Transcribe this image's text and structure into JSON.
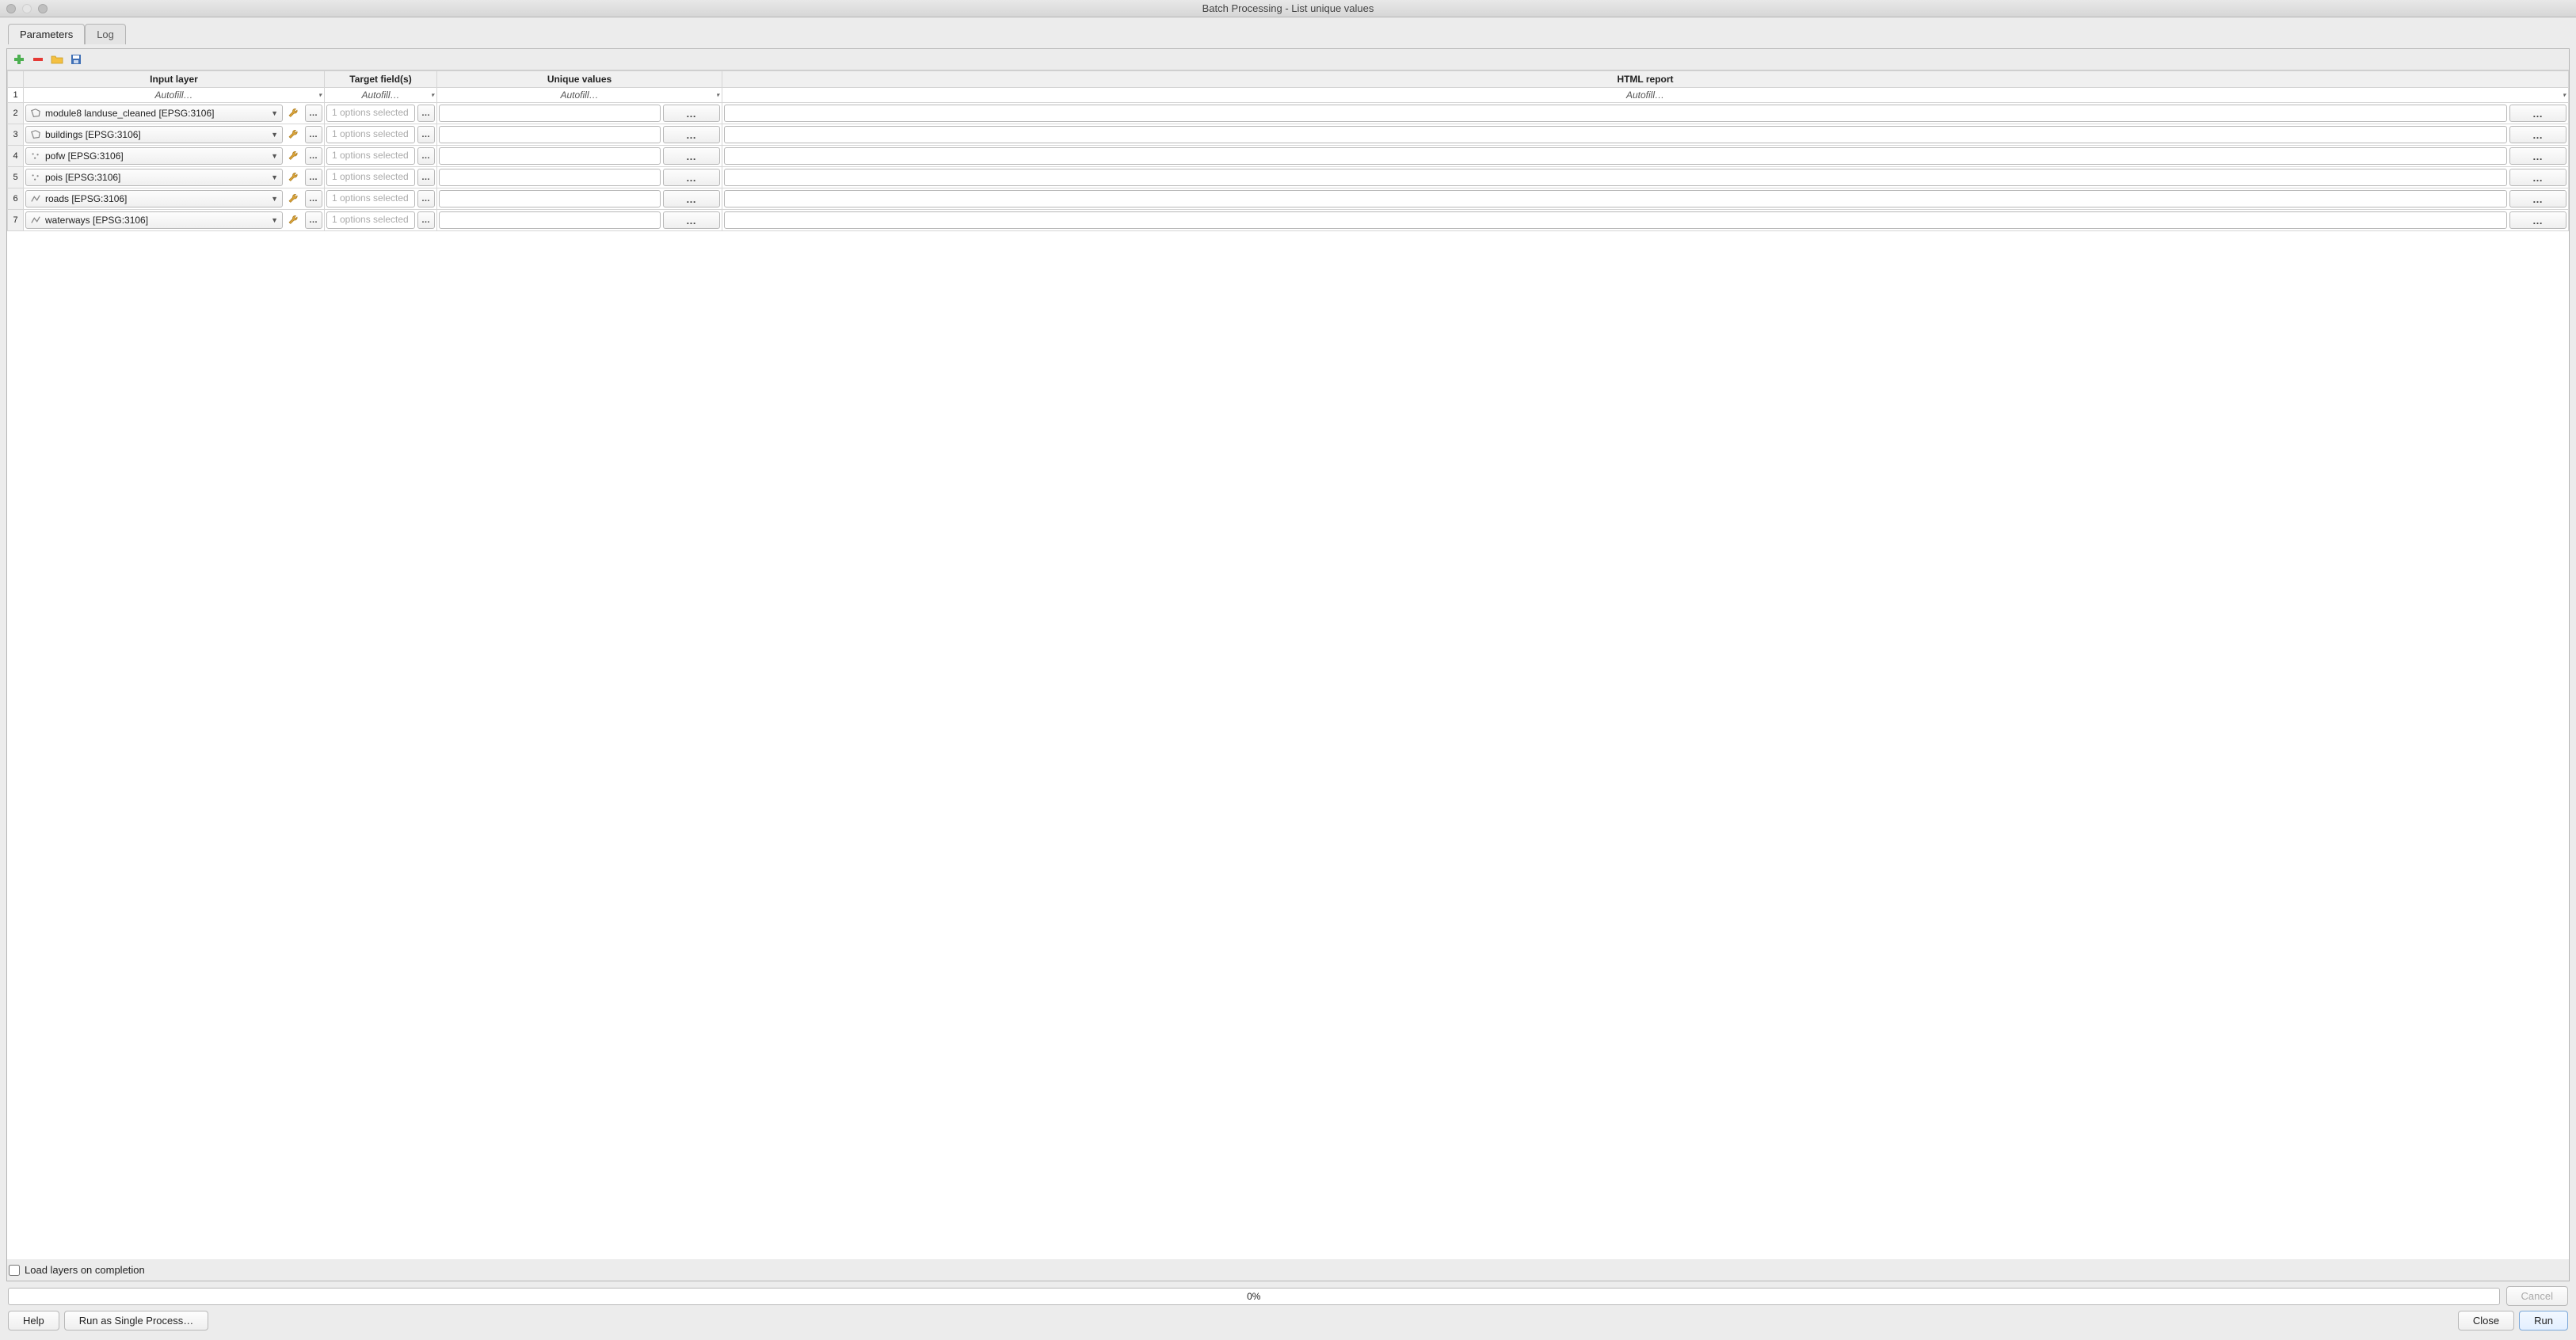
{
  "window": {
    "title": "Batch Processing - List unique values"
  },
  "tabs": {
    "parameters": "Parameters",
    "log": "Log"
  },
  "columns": {
    "input_layer": "Input layer",
    "target_fields": "Target field(s)",
    "unique_values": "Unique values",
    "html_report": "HTML report"
  },
  "autofill_label": "Autofill…",
  "target_placeholder": "1 options selected",
  "ellipsis": "…",
  "rows": [
    {
      "n": "2",
      "layer": "module8 landuse_cleaned [EPSG:3106]",
      "icon": "polygon"
    },
    {
      "n": "3",
      "layer": "buildings [EPSG:3106]",
      "icon": "polygon"
    },
    {
      "n": "4",
      "layer": "pofw [EPSG:3106]",
      "icon": "point"
    },
    {
      "n": "5",
      "layer": "pois [EPSG:3106]",
      "icon": "point"
    },
    {
      "n": "6",
      "layer": "roads [EPSG:3106]",
      "icon": "line"
    },
    {
      "n": "7",
      "layer": "waterways [EPSG:3106]",
      "icon": "line"
    }
  ],
  "footer": {
    "load_layers": "Load layers on completion",
    "progress": "0%",
    "cancel": "Cancel",
    "help": "Help",
    "run_single": "Run as Single Process…",
    "close": "Close",
    "run": "Run"
  }
}
